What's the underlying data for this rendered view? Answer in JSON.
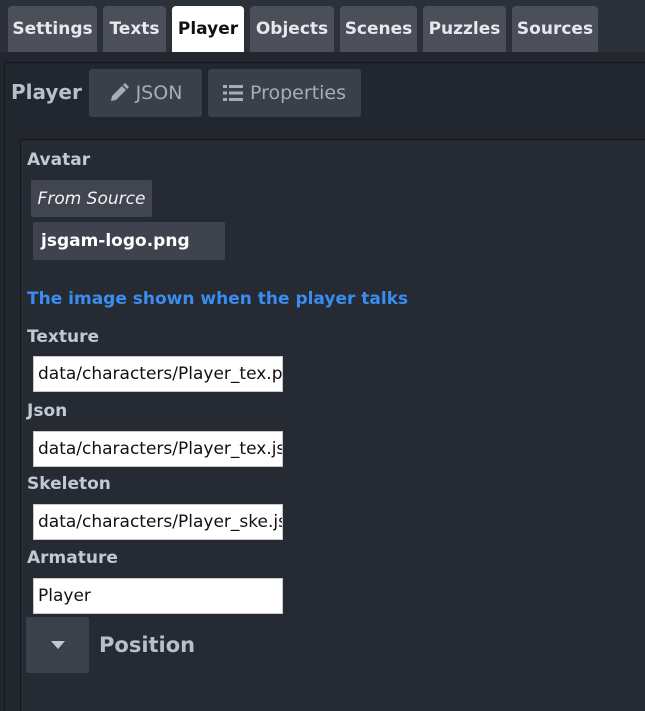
{
  "tabs": [
    {
      "label": "Settings"
    },
    {
      "label": "Texts"
    },
    {
      "label": "Player"
    },
    {
      "label": "Objects"
    },
    {
      "label": "Scenes"
    },
    {
      "label": "Puzzles"
    },
    {
      "label": "Sources"
    }
  ],
  "active_tab": "Player",
  "panel": {
    "title": "Player",
    "json_button": "JSON",
    "properties_button": "Properties"
  },
  "avatar": {
    "label": "Avatar",
    "from_source": "From Source",
    "file": "jsgam-logo.png",
    "hint": "The image shown when the player talks"
  },
  "fields": {
    "texture": {
      "label": "Texture",
      "value": "data/characters/Player_tex.png"
    },
    "json": {
      "label": "Json",
      "value": "data/characters/Player_tex.json"
    },
    "skeleton": {
      "label": "Skeleton",
      "value": "data/characters/Player_ske.json"
    },
    "armature": {
      "label": "Armature",
      "value": "Player"
    }
  },
  "position": {
    "label": "Position"
  },
  "icons": {
    "json": "pencil-icon",
    "properties": "list-icon",
    "position_toggle": "caret-down-icon"
  },
  "colors": {
    "background": "#22262e",
    "tab": "#4a4f59",
    "active_tab": "#ffffff",
    "hint": "#3b8cf0"
  }
}
